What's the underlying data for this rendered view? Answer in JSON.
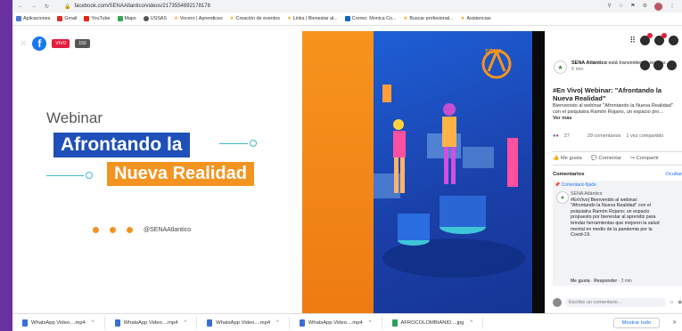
{
  "browser": {
    "url": "facebook.com/SENAAtlantico/videos/2173554892178178",
    "bookmarks": [
      {
        "label": "Aplicaciones",
        "color": "#4a7bd1"
      },
      {
        "label": "Gmail",
        "color": "#d93025"
      },
      {
        "label": "YouTube",
        "color": "#e62117"
      },
      {
        "label": "Maps",
        "color": "#34a853"
      },
      {
        "label": "USSAS",
        "color": "#555555"
      },
      {
        "label": "Vocero | Aprendices",
        "color": "#f5a623"
      },
      {
        "label": "Creación de eventos",
        "color": "#f5a623"
      },
      {
        "label": "Links | Bienestar al...",
        "color": "#f5a623"
      },
      {
        "label": "Correo: Monica Co...",
        "color": "#1565c0"
      },
      {
        "label": "Buscar profesional...",
        "color": "#f5a623"
      },
      {
        "label": "Asistencias",
        "color": "#f5a623"
      }
    ]
  },
  "video": {
    "webinar_label": "Webinar",
    "title_line1": "Afrontando la",
    "title_line2": "Nueva Realidad",
    "handle": "@SENAAtlantico",
    "live_badge": "VIVO",
    "views_badge": "150",
    "logo_text": "SENA",
    "colors": {
      "blue": "#1f4fb8",
      "orange": "#f39320"
    }
  },
  "sidebar": {
    "page_name": "SENA Atlántico",
    "page_status": "está transmitiendo en vivo.",
    "time": "5 min",
    "post_title": "#En Vivo| Webinar: \"Afrontando la Nueva Realidad\"",
    "post_body": "Bienvenido al webinar \"Afrontando la Nueva Realidad\" con el psiquiatra Ramón Rojano, un espacio pro...",
    "see_more": "Ver más",
    "reactions_count": "27",
    "comments_count": "29 comentarios",
    "shares": "1 vez compartido",
    "actions": [
      "Me gusta",
      "Comentar",
      "Compartir"
    ],
    "comments_header": "Comentarios",
    "comments_toggle": "Ocultar",
    "pinned_label": "Comentario fijado",
    "comment_author": "SENA Atlántico",
    "comment_text": "#EnVivo| Bienvenido al webinar: \"Afrontando la Nueva Realidad\" con el psiquiatra Ramón Rojano; un espacio propuesto por bienestar al aprendiz para brindar herramientas que mejoren la salud mental en medio de la pandemia por la Covid-19.",
    "comment_like": "Me gusta",
    "comment_reply": "Responder",
    "comment_time": "2 min",
    "composer_placeholder": "Escribe un comentario..."
  },
  "downloads": {
    "items": [
      "WhatsApp Video....mp4",
      "WhatsApp Video....mp4",
      "WhatsApp Video....mp4",
      "WhatsApp Video....mp4",
      "AFROCOLOMBIANID....jpg"
    ],
    "show_all": "Mostrar todo"
  }
}
